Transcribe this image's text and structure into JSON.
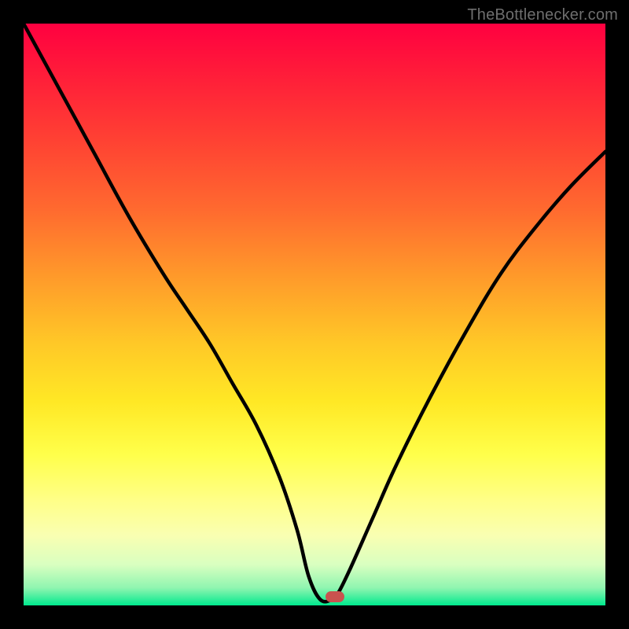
{
  "watermark": {
    "text": "TheBottlenecker.com"
  },
  "marker": {
    "x_frac": 0.535,
    "y_frac": 0.985,
    "color": "#c9524f"
  },
  "chart_data": {
    "type": "line",
    "title": "",
    "xlabel": "",
    "ylabel": "",
    "xlim": [
      0,
      100
    ],
    "ylim": [
      0,
      100
    ],
    "grid": false,
    "legend": false,
    "annotations": [],
    "background": "rainbow-vertical-gradient (red top → green bottom)",
    "series": [
      {
        "name": "bottleneck-curve",
        "x": [
          0,
          6,
          12,
          18,
          24,
          28,
          32,
          36,
          40,
          44,
          47,
          49,
          51,
          53,
          54,
          56,
          60,
          64,
          70,
          76,
          82,
          88,
          94,
          100
        ],
        "y": [
          100,
          89,
          78,
          67,
          57,
          51,
          45,
          38,
          31,
          22,
          13,
          5,
          1,
          1,
          2,
          6,
          15,
          24,
          36,
          47,
          57,
          65,
          72,
          78
        ]
      }
    ],
    "notes": "V-shaped black curve plotted over a vertical heat gradient. Minimum near x≈52. A small rounded red marker sits at the curve's minimum on the green band. Values are visual estimates (no axes labeled)."
  }
}
